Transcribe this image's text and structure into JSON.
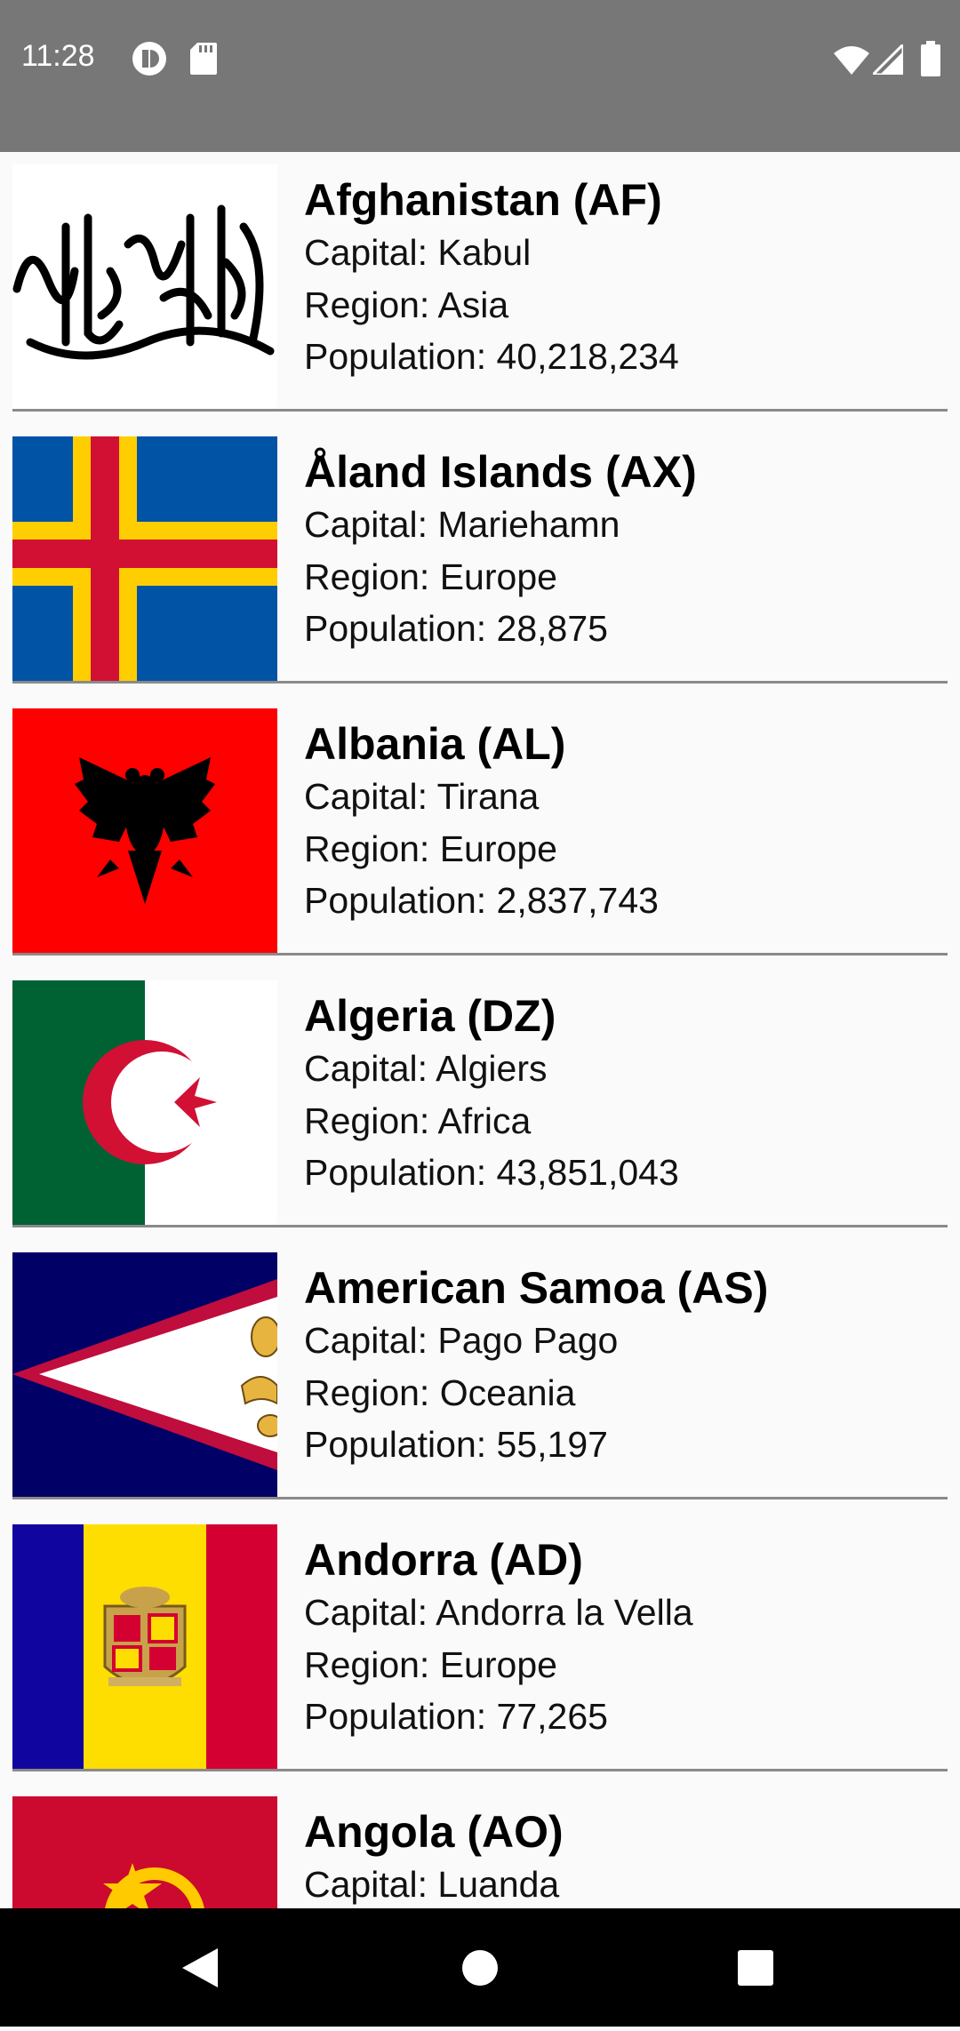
{
  "status_bar": {
    "time": "11:28",
    "icons_left": [
      "media-icon",
      "sd-card-icon"
    ],
    "icons_right": [
      "wifi-icon",
      "signal-icon",
      "battery-icon"
    ]
  },
  "countries": [
    {
      "name": "Afghanistan (AF)",
      "capital": "Capital: Kabul",
      "region": "Region: Asia",
      "population": "Population: 40,218,234",
      "flag": "afghanistan-flag"
    },
    {
      "name": "Åland Islands (AX)",
      "capital": "Capital: Mariehamn",
      "region": "Region: Europe",
      "population": "Population: 28,875",
      "flag": "aland-islands-flag"
    },
    {
      "name": "Albania (AL)",
      "capital": "Capital: Tirana",
      "region": "Region: Europe",
      "population": "Population: 2,837,743",
      "flag": "albania-flag"
    },
    {
      "name": "Algeria (DZ)",
      "capital": "Capital: Algiers",
      "region": "Region: Africa",
      "population": "Population: 43,851,043",
      "flag": "algeria-flag"
    },
    {
      "name": "American Samoa (AS)",
      "capital": "Capital: Pago Pago",
      "region": "Region: Oceania",
      "population": "Population: 55,197",
      "flag": "american-samoa-flag"
    },
    {
      "name": "Andorra (AD)",
      "capital": "Capital: Andorra la Vella",
      "region": "Region: Europe",
      "population": "Population: 77,265",
      "flag": "andorra-flag"
    },
    {
      "name": "Angola (AO)",
      "capital": "Capital: Luanda",
      "region": "",
      "population": "",
      "flag": "angola-flag"
    }
  ],
  "nav_bar": {
    "buttons": [
      "back-icon",
      "home-icon",
      "recents-icon"
    ]
  },
  "colors": {
    "status_bar": "#777777",
    "background": "#fafafa",
    "divider": "#8a8a8a",
    "nav_bar": "#000000"
  }
}
